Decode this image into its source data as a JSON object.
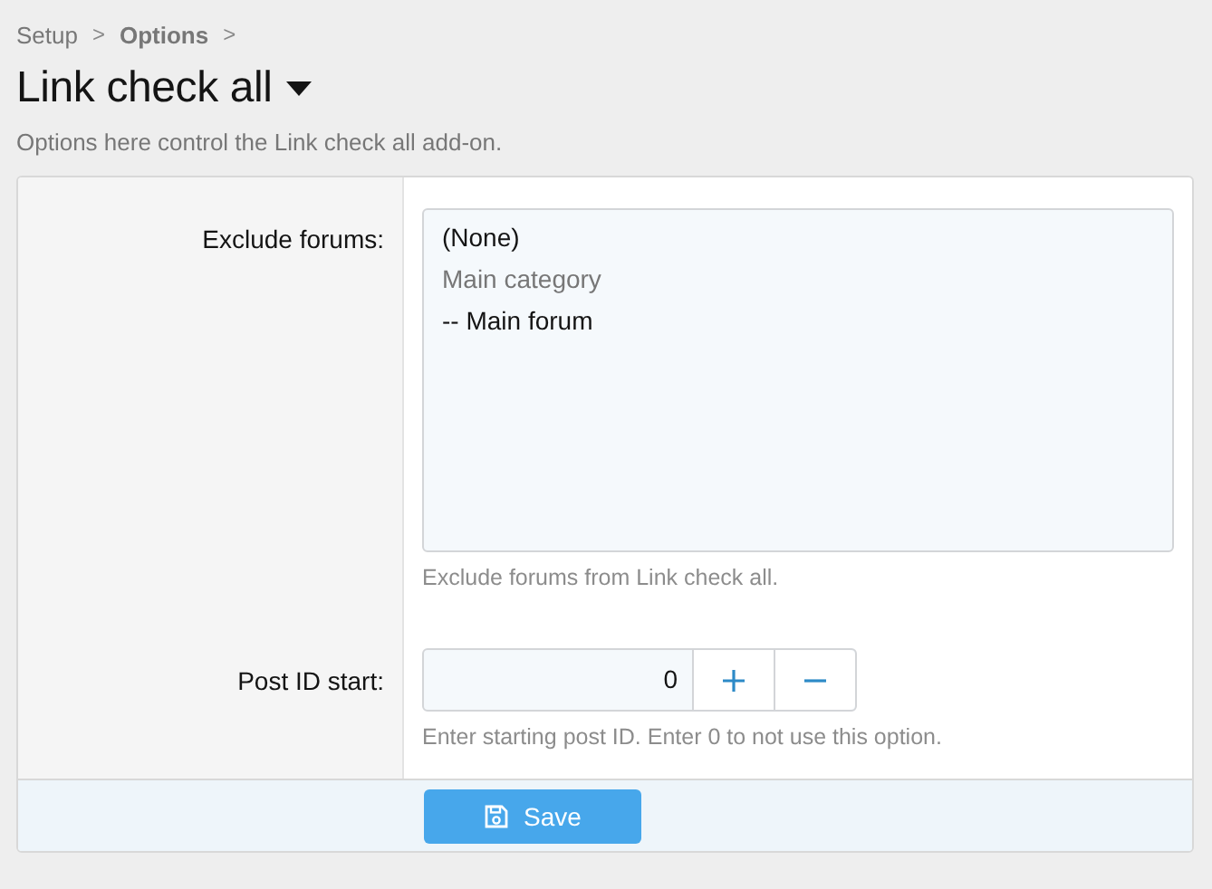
{
  "breadcrumbs": [
    {
      "label": "Setup",
      "current": false
    },
    {
      "label": "Options",
      "current": true
    }
  ],
  "breadcrumb_separator": ">",
  "title": "Link check all",
  "description": "Options here control the Link check all add-on.",
  "fields": [
    {
      "kind": "multiselect",
      "label": "Exclude forums:",
      "hint": "Exclude forums from Link check all.",
      "options": [
        {
          "label": "(None)",
          "kind": "option",
          "selected": false
        },
        {
          "label": "Main category",
          "kind": "group",
          "selected": false
        },
        {
          "label": "-- Main forum",
          "kind": "option",
          "selected": false
        }
      ]
    },
    {
      "kind": "number",
      "label": "Post ID start:",
      "value": "0",
      "hint": "Enter starting post ID. Enter 0 to not use this option."
    }
  ],
  "save_button": {
    "label": "Save"
  }
}
